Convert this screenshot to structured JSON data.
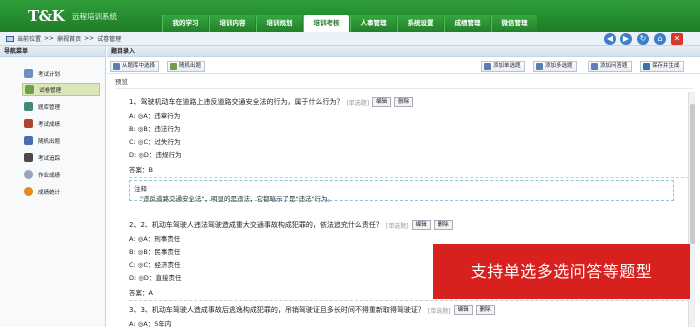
{
  "header": {
    "logo": "T&K",
    "system_name": "远程培训系统"
  },
  "nav": {
    "items": [
      {
        "label": "我的学习"
      },
      {
        "label": "培训内容"
      },
      {
        "label": "培训规划"
      },
      {
        "label": "培训考核",
        "active": true
      },
      {
        "label": "人事管理"
      },
      {
        "label": "系统设置"
      },
      {
        "label": "成绩管理"
      },
      {
        "label": "微信管理"
      }
    ]
  },
  "breadcrumb": {
    "items": [
      "当前位置",
      "鼎视首页",
      "试卷管理"
    ],
    "sep": ">>"
  },
  "sidebar": {
    "title": "导航菜单",
    "items": [
      {
        "label": "考试计划",
        "color": "#6b8fc2"
      },
      {
        "label": "试卷管理",
        "color": "#6aa14a",
        "active": true
      },
      {
        "label": "题库管理",
        "color": "#3f8a7a"
      },
      {
        "label": "考试成绩",
        "color": "#b0452f"
      },
      {
        "label": "随机出题",
        "color": "#4a6db0"
      },
      {
        "label": "考试追踪",
        "color": "#4a4a4a"
      },
      {
        "label": "作业成绩",
        "color": "#9aa6b5"
      },
      {
        "label": "成绩统计",
        "color": "#e58a1f"
      }
    ]
  },
  "main": {
    "title": "题目录入",
    "preview": "预览"
  },
  "toolbar": {
    "left": [
      {
        "label": "从题库中选择"
      },
      {
        "label": "随机出题"
      }
    ],
    "right": [
      {
        "label": "添加单选题"
      },
      {
        "label": "添加多选题"
      },
      {
        "label": "添加问答题"
      },
      {
        "label": "保存并生成"
      }
    ]
  },
  "questions": [
    {
      "title": "1、驾驶机动车在道路上违反道路交通安全法的行为，属于什么行为？",
      "type": "[单选题]",
      "edit": "编辑",
      "del": "删除",
      "options": [
        "A: ◎A：违章行为",
        "B: ◎B：违法行为",
        "C: ◎C：过失行为",
        "D: ◎D：违规行为"
      ],
      "answer": "答案：B",
      "note_label": "注释",
      "note": "\"违反道路交通安全法\"，明显的是违法，它都暗示了是\"违法\"行为。"
    },
    {
      "title": "2、2、机动车驾驶人违法驾驶造成重大交通事故构成犯罪的，依法追究什么责任？",
      "type": "[单选题]",
      "edit": "编辑",
      "del": "删除",
      "options": [
        "A: ◎A：刑事责任",
        "B: ◎B：民事责任",
        "C: ◎C：经济责任",
        "D: ◎D：直接责任"
      ],
      "answer": "答案：A"
    },
    {
      "title": "3、3、机动车驾驶人造成事故后逃逸构成犯罪的，吊销驾驶证且多长时间不得重新取得驾驶证？",
      "type": "[单选题]",
      "edit": "编辑",
      "del": "删除",
      "options": [
        "A: ◎A：5年内"
      ]
    }
  ],
  "banner": {
    "text": "支持单选多选问答等题型"
  },
  "icons": {
    "nav_back": "back-arrow-icon",
    "nav_forward": "forward-arrow-icon",
    "refresh": "refresh-icon",
    "home": "home-icon",
    "close": "close-icon"
  },
  "colors": {
    "brand_green": "#2a8f33",
    "banner_red": "#d8201e"
  }
}
